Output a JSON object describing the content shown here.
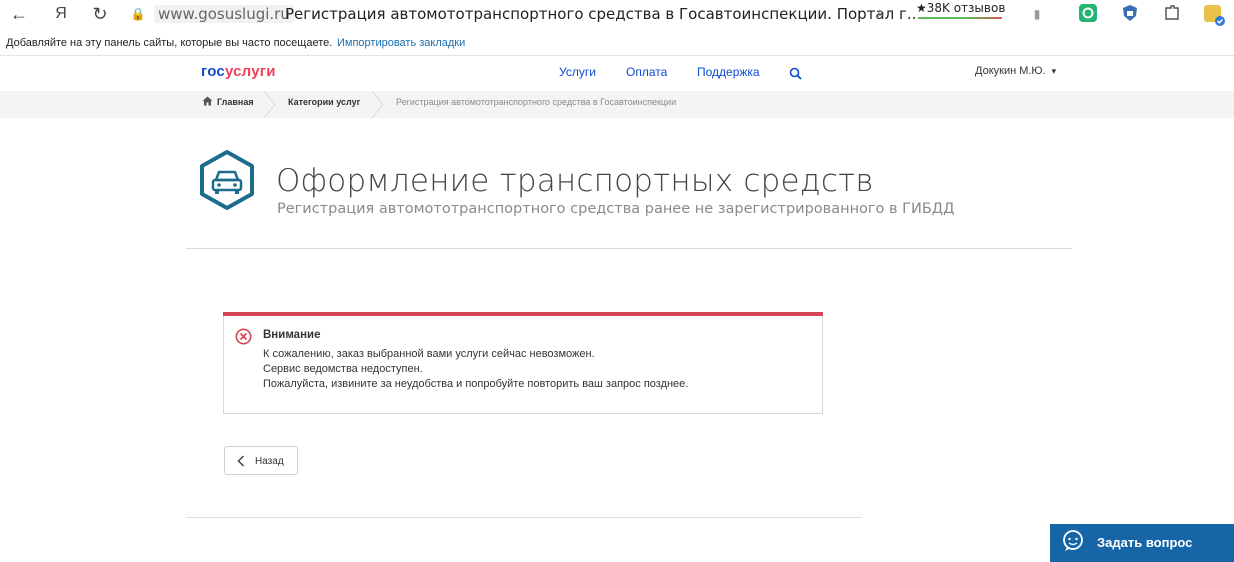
{
  "browser": {
    "back_glyph": "←",
    "yandex_glyph": "Я",
    "reload_glyph": "↻",
    "lock_glyph": "🔒",
    "url_domain": "www.gosuslugi.ru",
    "tab_title": "Регистрация автомототранспортного средства в Госавтоинспекции. Портал г...",
    "search_glyph": "⌕",
    "reviews": "★38K отзывов",
    "bookmark_glyph": "▮"
  },
  "bookmarks_bar": {
    "hint": "Добавляйте на эту панель сайты, которые вы часто посещаете.",
    "import_link": "Импортировать закладки"
  },
  "site_header": {
    "logo_part1": "гос",
    "logo_part2": "услуги",
    "nav": [
      "Услуги",
      "Оплата",
      "Поддержка"
    ],
    "user_name": "Докукин М.Ю.",
    "user_caret": "▾"
  },
  "breadcrumb": {
    "home": "Главная",
    "categories": "Категории услуг",
    "current": "Регистрация автомототранспортного средства в Госавтоинспекции"
  },
  "page": {
    "title": "Оформление транспортных средств",
    "subtitle": "Регистрация автомототранспортного средства ранее не зарегистрированного в ГИБДД"
  },
  "alert": {
    "heading": "Внимание",
    "lines": [
      "К сожалению, заказ выбранной вами услуги сейчас невозможен.",
      "Сервис ведомства недоступен.",
      "Пожалуйста, извините за неудобства и попробуйте повторить ваш запрос позднее."
    ]
  },
  "back_button": {
    "glyph": "‹",
    "label": "Назад"
  },
  "help_button": {
    "label": "Задать вопрос"
  },
  "colors": {
    "brand_blue": "#0d4cd3",
    "brand_red": "#ee3f58",
    "alert_red": "#d64556",
    "icon_teal": "#1c6c8c",
    "help_bg": "#1565a7"
  }
}
